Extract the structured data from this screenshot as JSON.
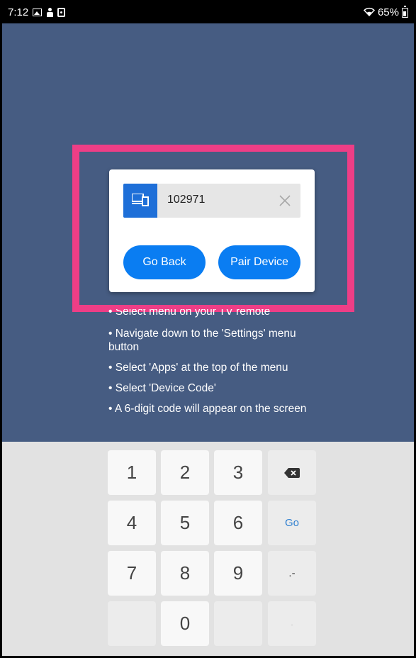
{
  "status_bar": {
    "time": "7:12",
    "battery": "65%"
  },
  "dialog": {
    "code_value": "102971",
    "go_back_label": "Go Back",
    "pair_device_label": "Pair Device"
  },
  "instructions": [
    "• Select menu on your TV remote",
    "• Navigate down to the 'Settings' menu button",
    "• Select 'Apps' at the top of the menu",
    "• Select 'Device Code'",
    "• A 6-digit code will appear on the screen"
  ],
  "keypad": {
    "keys": [
      "1",
      "2",
      "3",
      "4",
      "5",
      "6",
      "7",
      "8",
      "9",
      "0"
    ],
    "go_label": "Go",
    "punct_label": ".-",
    "dot_label": "."
  },
  "colors": {
    "background": "#465c82",
    "highlight": "#ee3e86",
    "button": "#0a7df2",
    "device_tile": "#1e6fd8"
  }
}
